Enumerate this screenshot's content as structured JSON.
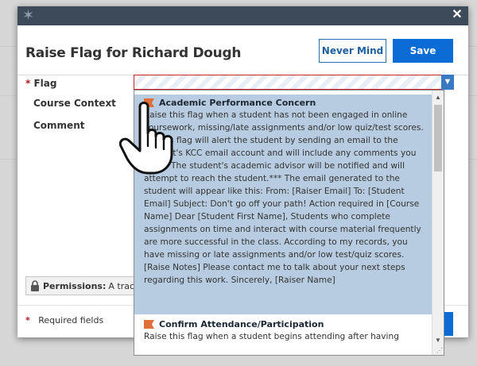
{
  "modal": {
    "title": "Raise Flag for Richard Dough",
    "never_mind_label": "Never Mind",
    "save_label": "Save"
  },
  "form": {
    "flag_label": "Flag",
    "course_context_label": "Course Context",
    "comment_label": "Comment",
    "required_marker": "*",
    "permissions_label": "Permissions:",
    "permissions_text": "A tracki",
    "required_note": "Required fields"
  },
  "dropdown": {
    "options": [
      {
        "title": "Academic Performance Concern",
        "description": "Raise this flag when a student has not been engaged in online coursework, missing/late assignments and/or low quiz/test scores. ***This flag will alert the student by sending an email to the student's KCC email account and will include any comments you enter. The student's academic advisor will be notified and will attempt to reach the student.*** The email generated to the student will appear like this: From: [Raiser Email] To: [Student Email] Subject: Don't go off your path! Action required in [Course Name] Dear [Student First Name], Students who complete assignments on time and interact with course material frequently are more successful in the class. According to my records, you have missing or late assignments and/or low test/quiz scores. [Raise Notes] Please contact me to talk about your next steps regarding this work. Sincerely, [Raiser Name]"
      },
      {
        "title": "Confirm Attendance/Participation",
        "description": "Raise this flag when a student begins attending after having"
      }
    ]
  },
  "colors": {
    "topbar": "#3d4a5a",
    "save_button": "#0b6cd6",
    "selected_option": "#b7cce0",
    "flag_icon": "#e0703a",
    "required_star": "#b3161b"
  },
  "icons": {
    "close": "close-icon",
    "logo": "star-logo-icon",
    "flag": "flag-icon",
    "lock": "lock-icon",
    "chevron": "chevron-down-icon",
    "cursor": "hand-pointer-icon"
  }
}
